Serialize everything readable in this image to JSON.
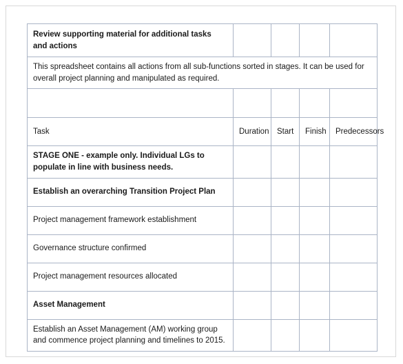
{
  "document": {
    "title_row": "Review supporting material for additional tasks and actions",
    "description_row": "This spreadsheet contains all actions from all sub-functions sorted in stages. It can be used for overall project planning and manipulated as required.",
    "spacer_row": ""
  },
  "table": {
    "columns": [
      {
        "key": "task",
        "label": "Task"
      },
      {
        "key": "duration",
        "label": "Duration"
      },
      {
        "key": "start",
        "label": "Start"
      },
      {
        "key": "finish",
        "label": "Finish"
      },
      {
        "key": "predecessors",
        "label": "Predecessors"
      }
    ],
    "rows": [
      {
        "type": "stage",
        "task": "STAGE ONE - example only. Individual LGs to populate in line with business needs.",
        "duration": "",
        "start": "",
        "finish": "",
        "predecessors": ""
      },
      {
        "type": "group",
        "task": "Establish an overarching Transition Project Plan",
        "duration": "",
        "start": "",
        "finish": "",
        "predecessors": ""
      },
      {
        "type": "item",
        "task": "Project management framework establishment",
        "duration": "",
        "start": "",
        "finish": "",
        "predecessors": ""
      },
      {
        "type": "item",
        "task": "Governance structure confirmed",
        "duration": "",
        "start": "",
        "finish": "",
        "predecessors": ""
      },
      {
        "type": "item",
        "task": "Project management resources allocated",
        "duration": "",
        "start": "",
        "finish": "",
        "predecessors": ""
      },
      {
        "type": "group",
        "task": "Asset Management",
        "duration": "",
        "start": "",
        "finish": "",
        "predecessors": ""
      },
      {
        "type": "item2",
        "task": "Establish an Asset Management (AM) working group and commence project planning and timelines to 2015.",
        "duration": "",
        "start": "",
        "finish": "",
        "predecessors": ""
      }
    ]
  },
  "colors": {
    "header_background": "#dcdfe5",
    "grid_border": "#aab4c6",
    "page_border": "#d8d8d8",
    "text": "#1a1a1a"
  }
}
